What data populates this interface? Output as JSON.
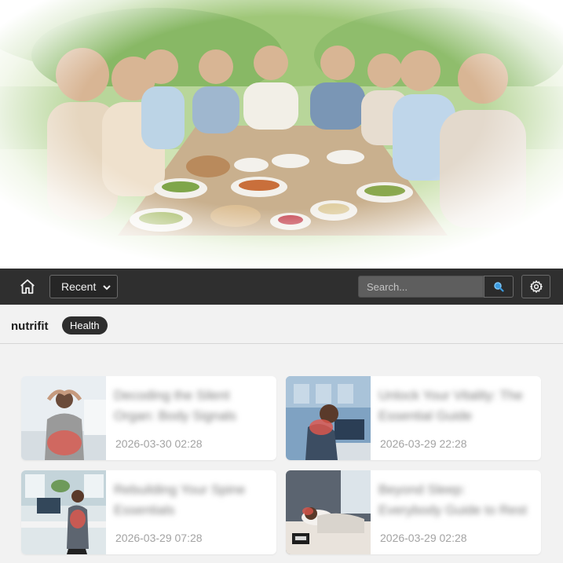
{
  "hero": {
    "alt": "Friends sharing a healthy meal at an outdoor table"
  },
  "nav": {
    "select_value": "Recent",
    "search_placeholder": "Search..."
  },
  "brand": {
    "name": "nutrifit",
    "badge": "Health"
  },
  "articles": [
    {
      "title": "Decoding the Silent Organ: Body Signals",
      "date": "2026-03-30 02:28"
    },
    {
      "title": "Unlock Your Vitality: The Essential Guide",
      "date": "2026-03-29 22:28"
    },
    {
      "title": "Rebuilding Your Spine Essentials",
      "date": "2026-03-29 07:28"
    },
    {
      "title": "Beyond Sleep: Everybody Guide to Rest",
      "date": "2026-03-29 02:28"
    }
  ],
  "colors": {
    "nav_bg": "#2f2f2f",
    "page_bg": "#f2f2f2",
    "search_accent": "#2f8fd8",
    "badge_bg": "#2e2e2e"
  }
}
